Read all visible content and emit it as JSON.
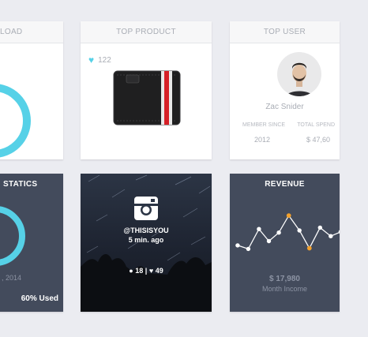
{
  "cards": {
    "load": {
      "title": "LOAD"
    },
    "top_product": {
      "title": "TOP PRODUCT",
      "likes": "122"
    },
    "top_user": {
      "title": "TOP USER",
      "name": "Zac Snider",
      "member_since_label": "MEMBER SINCE",
      "member_since_value": "2012",
      "total_spend_label": "TOTAL SPEND",
      "total_spend_value": "$ 47,60"
    },
    "statics": {
      "title": "STATICS",
      "year": ", 2014",
      "used": "60% Used",
      "used_fraction": 0.6
    },
    "instagram": {
      "handle": "@THISISYOU",
      "time": "5 min. ago",
      "comments": "18",
      "likes": "49"
    },
    "revenue": {
      "title": "REVENUE",
      "amount": "$ 17,980",
      "label": "Month Income"
    }
  },
  "colors": {
    "accent_cyan": "#56d1e7",
    "accent_orange": "#f2a02b",
    "dark_card": "#434b5c"
  }
}
